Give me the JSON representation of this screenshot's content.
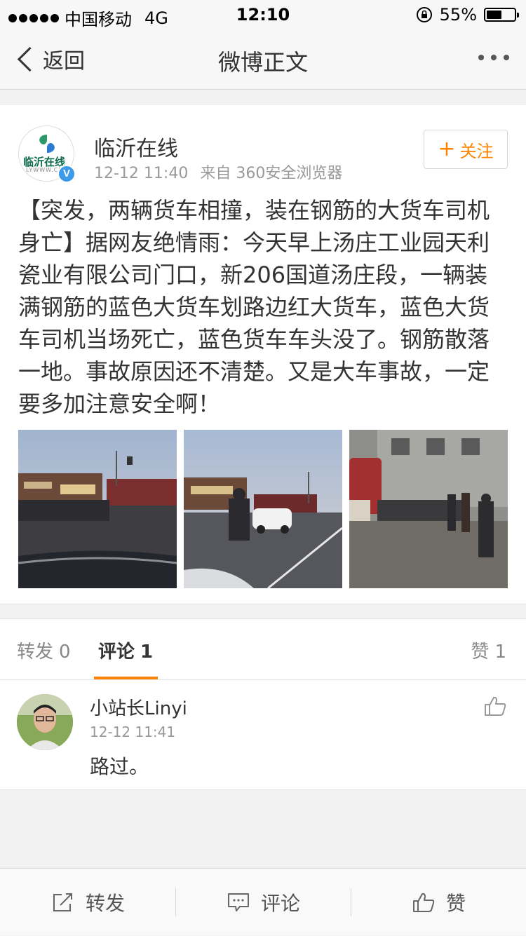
{
  "status_bar": {
    "carrier": "中国移动",
    "network": "4G",
    "time": "12:10",
    "battery_text": "55%",
    "battery_level": 0.55
  },
  "nav": {
    "back_label": "返回",
    "title": "微博正文"
  },
  "post": {
    "author": "临沂在线",
    "avatar_text": "临沂在线",
    "avatar_subtext": "LYWWW.CN",
    "verified_badge": "V",
    "time": "12-12 11:40",
    "source": "来自 360安全浏览器",
    "follow_label": "关注",
    "text": "【突发，两辆货车相撞，装在钢筋的大货车司机身亡】据网友绝情雨：今天早上汤庄工业园天利瓷业有限公司门口，新206国道汤庄段，一辆装满钢筋的蓝色大货车划路边红大货车，蓝色大货车司机当场死亡，蓝色货车车头没了。钢筋散落一地。事故原因还不清楚。又是大车事故，一定要多加注意安全啊！"
  },
  "tabs": {
    "repost_label": "转发",
    "repost_count": "0",
    "comment_label": "评论",
    "comment_count": "1",
    "like_label": "赞",
    "like_count": "1"
  },
  "comments": [
    {
      "user": "小站长Linyi",
      "time": "12-12 11:41",
      "text": "路过。"
    }
  ],
  "bottom_bar": {
    "repost_label": "转发",
    "comment_label": "评论",
    "like_label": "赞"
  },
  "colors": {
    "accent": "#ff8200",
    "verified": "#3c9ae8"
  }
}
